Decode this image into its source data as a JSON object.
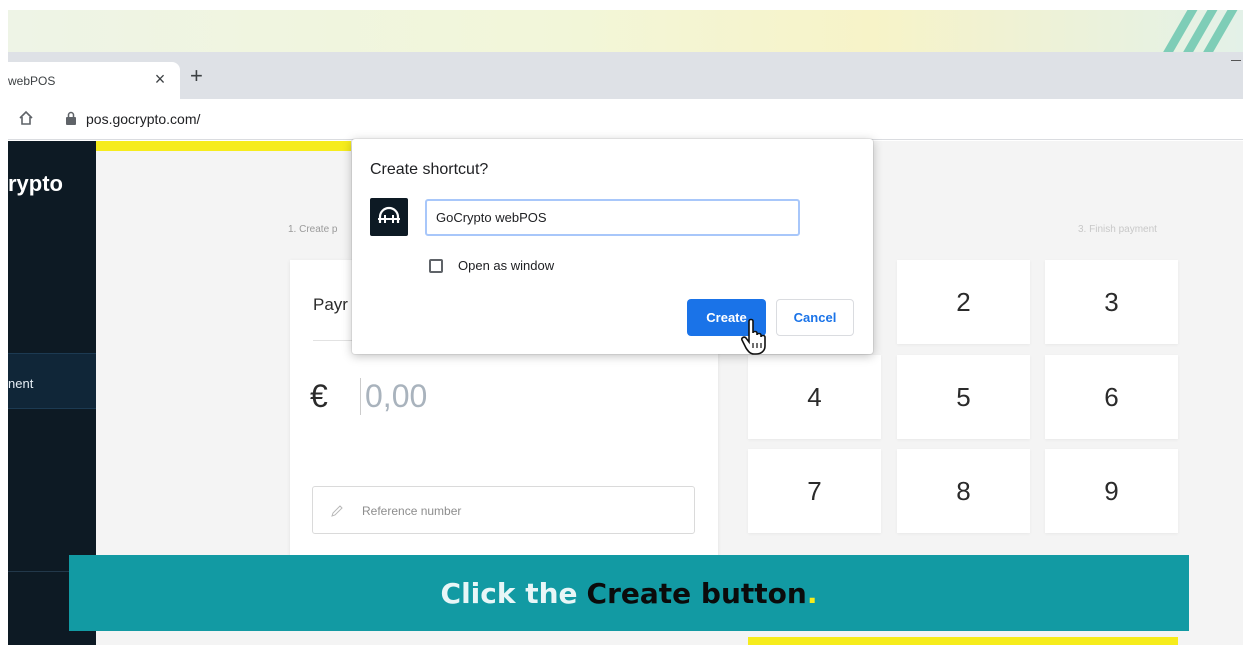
{
  "browser": {
    "tab_title": "webPOS",
    "tab_close": "×",
    "new_tab": "+",
    "url": "pos.gocrypto.com/"
  },
  "sidebar": {
    "brand": "rypto",
    "active_item": "nent"
  },
  "page": {
    "step_1": "1. Create p",
    "step_3": "3. Finish payment",
    "payment_label": "Payr",
    "currency_symbol": "€",
    "amount_placeholder": "0,00",
    "reference_placeholder": "Reference number",
    "keypad": [
      "2",
      "3",
      "4",
      "5",
      "6",
      "7",
      "8",
      "9"
    ]
  },
  "dialog": {
    "title": "Create shortcut?",
    "name_value": "GoCrypto webPOS",
    "open_as_window_label": "Open as window",
    "open_as_window_checked": false,
    "create_label": "Create",
    "cancel_label": "Cancel"
  },
  "caption": {
    "part_1": "Click the",
    "part_2": "Create button",
    "part_3": "."
  },
  "colors": {
    "accent_blue": "#1a73e8",
    "brand_yellow": "#f6ec1c",
    "sidebar_dark": "#0d1a24",
    "caption_teal": "#129aa3"
  }
}
